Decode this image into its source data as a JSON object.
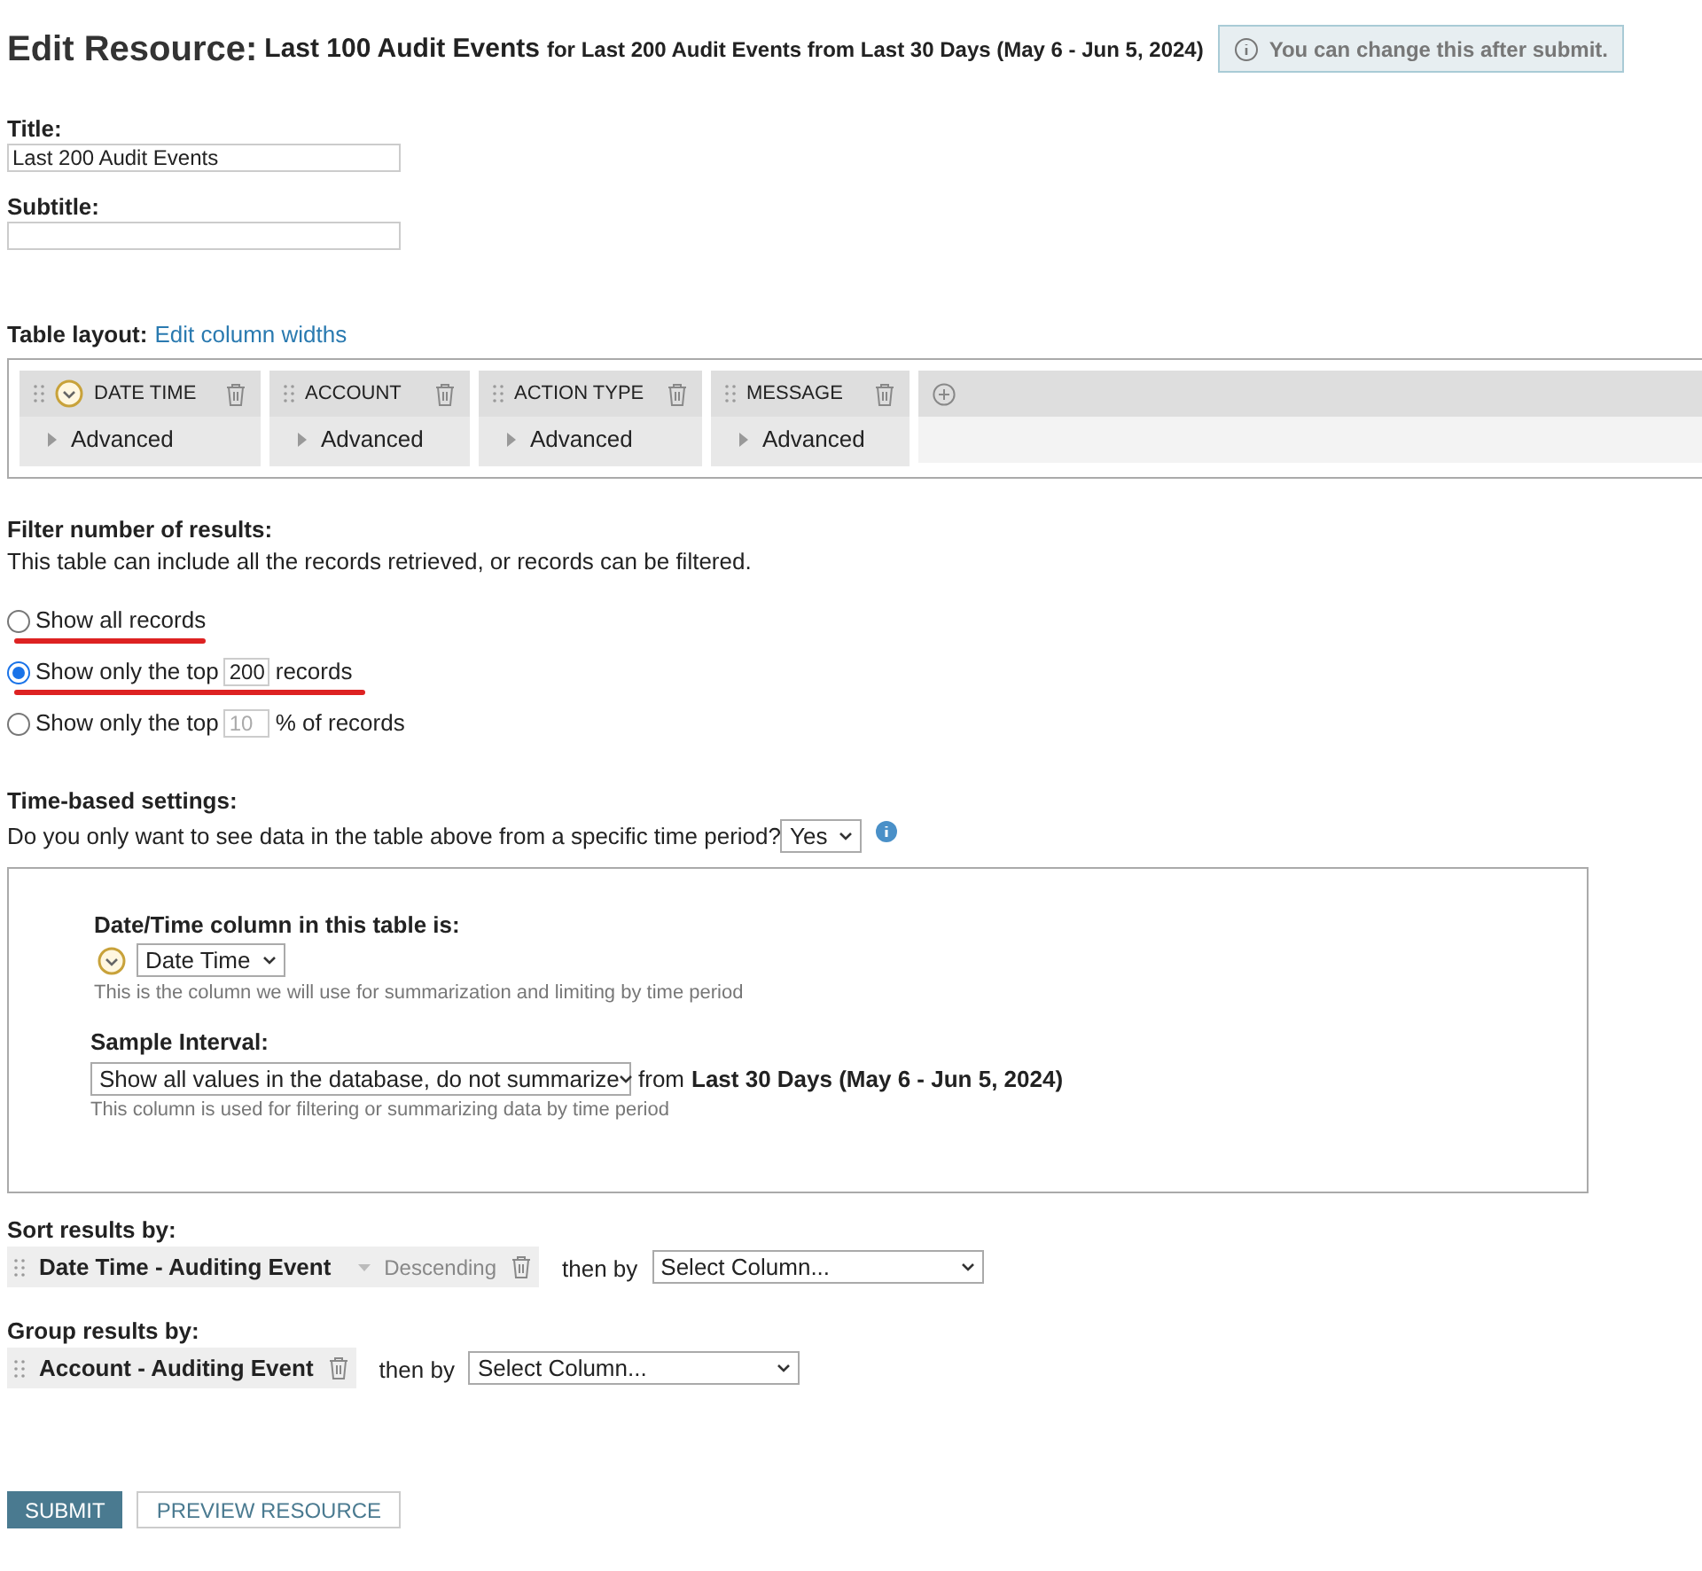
{
  "header": {
    "title": "Edit Resource:",
    "resource_name": "Last 100 Audit Events",
    "subtitle": "for Last 200 Audit Events from Last 30 Days (May 6 - Jun 5, 2024)",
    "note": "You can change this after submit."
  },
  "title_field": {
    "label": "Title:",
    "value": "Last 200 Audit Events"
  },
  "subtitle_field": {
    "label": "Subtitle:"
  },
  "table_layout": {
    "label": "Table layout:",
    "link": "Edit column widths",
    "columns": [
      {
        "name": "DATE TIME",
        "time_column": true,
        "advanced": "Advanced"
      },
      {
        "name": "ACCOUNT",
        "time_column": false,
        "advanced": "Advanced"
      },
      {
        "name": "ACTION TYPE",
        "time_column": false,
        "advanced": "Advanced"
      },
      {
        "name": "MESSAGE",
        "time_column": false,
        "advanced": "Advanced"
      }
    ]
  },
  "filter": {
    "heading": "Filter number of results:",
    "description": "This table can include all the records retrieved, or records can be filtered.",
    "options": [
      {
        "kind": "plain",
        "label": "Show all records",
        "selected": false,
        "underlined": true
      },
      {
        "kind": "input",
        "before": "Show only the top",
        "value": "200",
        "after": "records",
        "selected": true,
        "underlined": true,
        "disabled": false
      },
      {
        "kind": "input",
        "before": "Show only the top",
        "value": "10",
        "after": "% of records",
        "selected": false,
        "underlined": false,
        "disabled": true
      }
    ]
  },
  "time_settings": {
    "heading": "Time-based settings:",
    "question": "Do you only want to see data in the table above from a specific time period?",
    "answer": "Yes",
    "column_label": "Date/Time column in this table is:",
    "column_value": "Date Time",
    "column_hint": "This is the column we will use for summarization and limiting by time period",
    "interval_label": "Sample Interval:",
    "interval_value": "Show all values in the database, do not summarize",
    "from_word": "from",
    "period": "Last 30 Days (May 6 - Jun 5, 2024)",
    "interval_hint": "This column is used for filtering or summarizing data by time period"
  },
  "sort": {
    "heading": "Sort results by:",
    "item": "Date Time - Auditing Event",
    "order": "Descending",
    "then_by": "then by",
    "select": "Select Column..."
  },
  "group": {
    "heading": "Group results by:",
    "item": "Account - Auditing Event",
    "then_by": "then by",
    "select": "Select Column..."
  },
  "buttons": [
    {
      "kind": "primary",
      "label": "SUBMIT"
    },
    {
      "kind": "secondary",
      "label": "PREVIEW RESOURCE"
    }
  ]
}
